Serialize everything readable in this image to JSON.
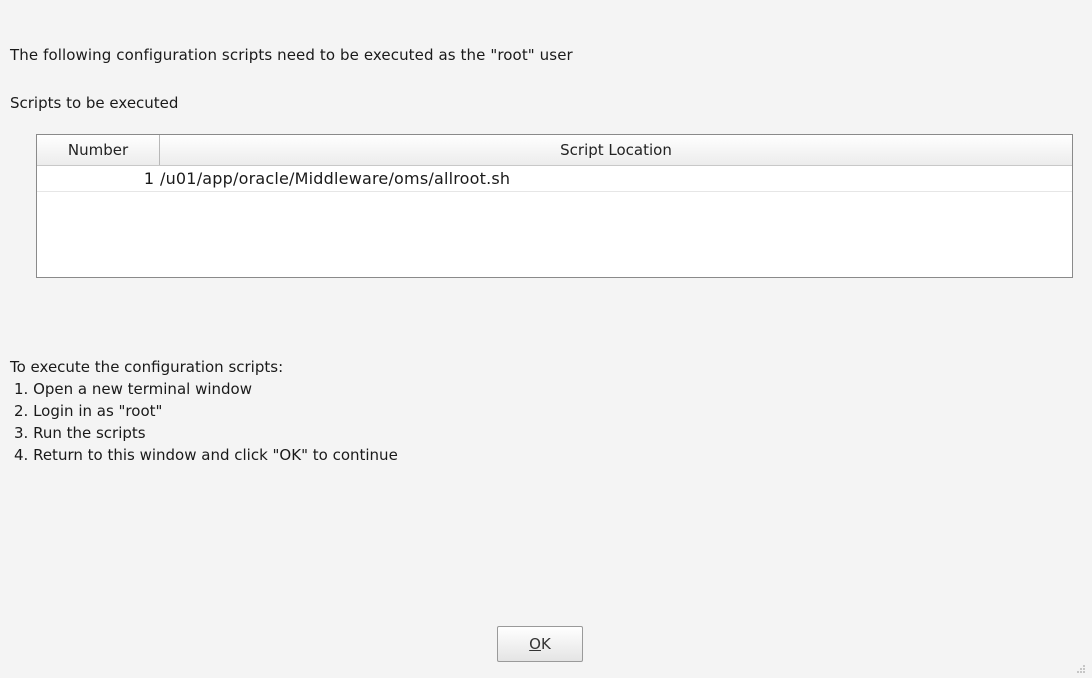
{
  "intro_text": "The following configuration scripts need to be executed as the \"root\" user",
  "scripts_label": "Scripts to be executed",
  "table": {
    "columns": [
      "Number",
      "Script Location"
    ],
    "rows": [
      {
        "number": "1",
        "location": "/u01/app/oracle/Middleware/oms/allroot.sh"
      }
    ]
  },
  "instructions": {
    "heading": "To execute the configuration scripts:",
    "steps": [
      "1. Open a new terminal window",
      "2. Login in as \"root\"",
      "3. Run the scripts",
      "4. Return to this window and click \"OK\" to continue"
    ]
  },
  "ok_button": {
    "mnemonic": "O",
    "rest": "K"
  },
  "icons": {
    "resize_grip": "resize-grip-icon"
  }
}
